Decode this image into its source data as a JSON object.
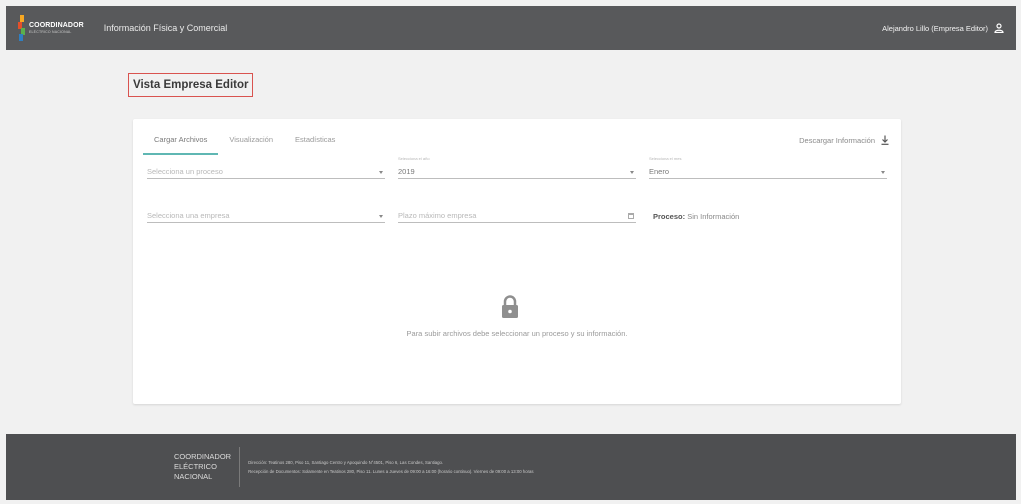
{
  "header": {
    "logo_title": "COORDINADOR",
    "logo_subtitle": "ELÉCTRICO NACIONAL",
    "app_title": "Información Física y Comercial",
    "user_label": "Alejandro Lillo (Empresa Editor)",
    "user_icon": "user-icon"
  },
  "page": {
    "title": "Vista Empresa Editor"
  },
  "tabs": [
    {
      "label": "Cargar Archivos",
      "active": true
    },
    {
      "label": "Visualización",
      "active": false
    },
    {
      "label": "Estadísticas",
      "active": false
    }
  ],
  "download": {
    "label": "Descargar Información",
    "icon": "download-icon"
  },
  "filters": {
    "proceso": {
      "placeholder": "Selecciona un proceso"
    },
    "anio": {
      "label": "Selecciona el año",
      "value": "2019"
    },
    "mes": {
      "label": "Selecciona el mes",
      "value": "Enero"
    },
    "empresa": {
      "placeholder": "Selecciona una empresa"
    },
    "plazo": {
      "placeholder": "Plazo máximo empresa"
    }
  },
  "status": {
    "proceso_label": "Proceso:",
    "proceso_value": "Sin Información"
  },
  "empty_state": {
    "icon": "lock-icon",
    "message": "Para subir archivos debe seleccionar un proceso y su información."
  },
  "footer": {
    "logo_line1": "COORDINADOR",
    "logo_line2": "ELÉCTRICO",
    "logo_line3": "NACIONAL",
    "address": "Dirección: Teatinos 280, Piso 11, Santiago Centro y Apoquindo N°4501, Piso 6, Las Condes, Santiago.",
    "hours": "Recepción de Documentos: Solamente en Teatinos 280, Piso 11. Lunes a Jueves de 09:00 a 16:00 (horario continuo). Viernes de 09:00 a 13:00 horas"
  },
  "colors": {
    "topbar": "#58595b",
    "footer": "#4e4f51",
    "accent_tab": "#5fb7b3",
    "title_border": "#d9534f"
  }
}
